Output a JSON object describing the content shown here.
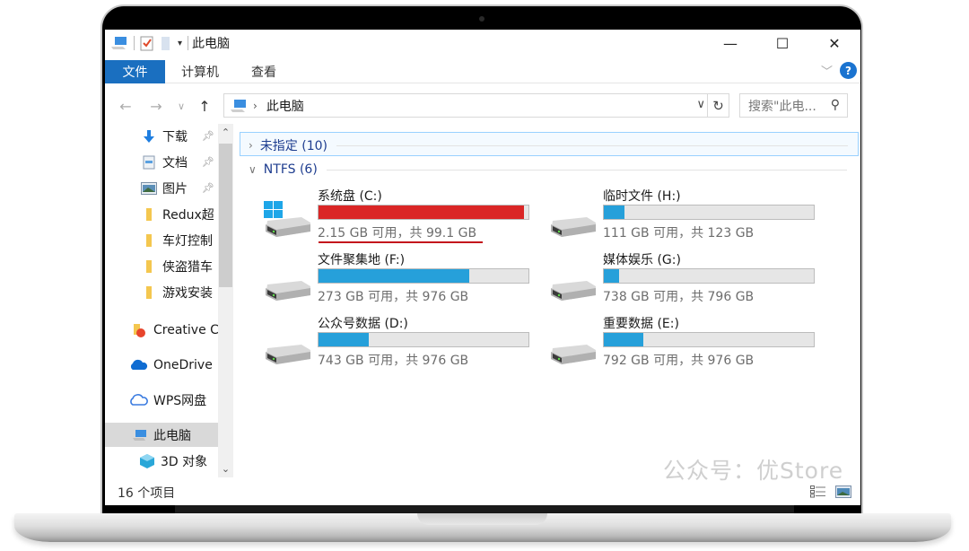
{
  "window": {
    "title": "此电脑",
    "controls": {
      "minimize": "—",
      "maximize": "☐",
      "close": "✕"
    }
  },
  "ribbon": {
    "tabs": [
      "文件",
      "计算机",
      "查看"
    ],
    "help": "?"
  },
  "address": {
    "crumb": "此电脑",
    "search_placeholder": "搜索\"此电..."
  },
  "sidebar": {
    "items": [
      {
        "label": "下载",
        "icon": "download-icon",
        "pinned": true
      },
      {
        "label": "文档",
        "icon": "document-icon",
        "pinned": true
      },
      {
        "label": "图片",
        "icon": "picture-icon",
        "pinned": true
      },
      {
        "label": "Redux超",
        "icon": "folder-icon",
        "pinned": false
      },
      {
        "label": "车灯控制",
        "icon": "folder-icon",
        "pinned": false
      },
      {
        "label": "侠盗猎车",
        "icon": "folder-icon",
        "pinned": false
      },
      {
        "label": "游戏安装",
        "icon": "folder-icon",
        "pinned": false
      },
      {
        "label": "Creative C",
        "icon": "creative-cloud-icon",
        "pinned": false
      },
      {
        "label": "OneDrive",
        "icon": "onedrive-icon",
        "pinned": false
      },
      {
        "label": "WPS网盘",
        "icon": "wps-cloud-icon",
        "pinned": false
      },
      {
        "label": "此电脑",
        "icon": "this-pc-icon",
        "pinned": false,
        "selected": true
      },
      {
        "label": "3D 对象",
        "icon": "3d-objects-icon",
        "pinned": false
      }
    ]
  },
  "groups": [
    {
      "label": "未指定 (10)",
      "expanded": false
    },
    {
      "label": "NTFS (6)",
      "expanded": true
    }
  ],
  "drives": [
    {
      "name": "系统盘 (C:)",
      "info": "2.15 GB 可用，共 99.1 GB",
      "used_fraction": 0.978,
      "critical": true,
      "system": true
    },
    {
      "name": "临时文件 (H:)",
      "info": "111 GB 可用，共 123 GB",
      "used_fraction": 0.098,
      "critical": false,
      "system": false
    },
    {
      "name": "文件聚集地 (F:)",
      "info": "273 GB 可用，共 976 GB",
      "used_fraction": 0.72,
      "critical": false,
      "system": false
    },
    {
      "name": "媒体娱乐 (G:)",
      "info": "738 GB 可用，共 796 GB",
      "used_fraction": 0.073,
      "critical": false,
      "system": false
    },
    {
      "name": "公众号数据 (D:)",
      "info": "743 GB 可用，共 976 GB",
      "used_fraction": 0.239,
      "critical": false,
      "system": false
    },
    {
      "name": "重要数据 (E:)",
      "info": "792 GB 可用，共 976 GB",
      "used_fraction": 0.189,
      "critical": false,
      "system": false
    }
  ],
  "status": {
    "item_count": "16 个项目"
  },
  "watermark": "公众号：优Store",
  "colors": {
    "accent": "#1a6fc0",
    "bar_normal": "#26a0da",
    "bar_critical": "#da2626",
    "annotation": "#c4161c"
  }
}
